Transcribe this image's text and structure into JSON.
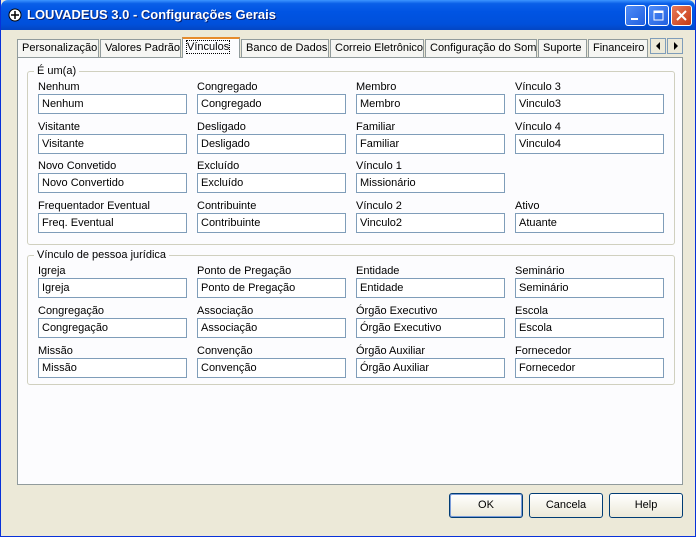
{
  "window": {
    "title": "LOUVADEUS 3.0 - Configurações Gerais"
  },
  "tabs": [
    {
      "label": "Personalização"
    },
    {
      "label": "Valores Padrão"
    },
    {
      "label": "Vínculos",
      "active": true
    },
    {
      "label": "Banco de Dados"
    },
    {
      "label": "Correio Eletrônico"
    },
    {
      "label": "Configuração do Som"
    },
    {
      "label": "Suporte"
    },
    {
      "label": "Financeiro"
    }
  ],
  "group1": {
    "legend": "É um(a)",
    "fields": [
      {
        "label": "Nenhum",
        "value": "Nenhum"
      },
      {
        "label": "Congregado",
        "value": "Congregado"
      },
      {
        "label": "Membro",
        "value": "Membro"
      },
      {
        "label": "Vínculo 3",
        "value": "Vinculo3"
      },
      {
        "label": "Visitante",
        "value": "Visitante"
      },
      {
        "label": "Desligado",
        "value": "Desligado"
      },
      {
        "label": "Familiar",
        "value": "Familiar"
      },
      {
        "label": "Vínculo 4",
        "value": "Vinculo4"
      },
      {
        "label": "Novo Convetido",
        "value": "Novo Convertido"
      },
      {
        "label": "Excluído",
        "value": "Excluído"
      },
      {
        "label": "Vínculo 1",
        "value": "Missionário"
      },
      {
        "label": "Frequentador Eventual",
        "value": "Freq. Eventual"
      },
      {
        "label": "Contribuinte",
        "value": "Contribuinte"
      },
      {
        "label": "Vínculo 2",
        "value": "Vinculo2"
      },
      {
        "label": "Ativo",
        "value": "Atuante"
      }
    ]
  },
  "group2": {
    "legend": "Vínculo de pessoa jurídica",
    "fields": [
      {
        "label": "Igreja",
        "value": "Igreja"
      },
      {
        "label": "Ponto de Pregação",
        "value": "Ponto de Pregação"
      },
      {
        "label": "Entidade",
        "value": "Entidade"
      },
      {
        "label": "Seminário",
        "value": "Seminário"
      },
      {
        "label": "Congregação",
        "value": "Congregação"
      },
      {
        "label": "Associação",
        "value": "Associação"
      },
      {
        "label": "Órgão Executivo",
        "value": "Órgão Executivo"
      },
      {
        "label": "Escola",
        "value": "Escola"
      },
      {
        "label": "Missão",
        "value": "Missão"
      },
      {
        "label": "Convenção",
        "value": "Convenção"
      },
      {
        "label": "Órgão Auxiliar",
        "value": "Órgão Auxiliar"
      },
      {
        "label": "Fornecedor",
        "value": "Fornecedor"
      }
    ]
  },
  "buttons": {
    "ok": "OK",
    "cancel": "Cancela",
    "help": "Help"
  },
  "colors": {
    "titlebar": "#0054e3",
    "face": "#ece9d8",
    "active_tab_accent": "#e68b2c"
  }
}
